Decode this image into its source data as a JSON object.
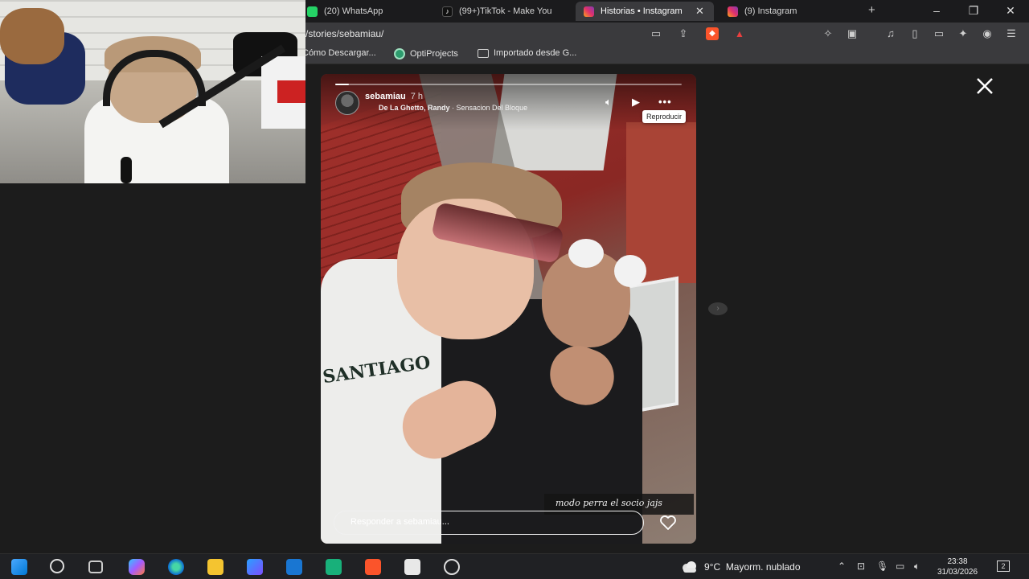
{
  "browser": {
    "tabs": [
      {
        "title": "(20) WhatsApp",
        "icon": "whatsapp-icon",
        "active": false
      },
      {
        "title": "(99+)TikTok - Make You",
        "icon": "tiktok-icon",
        "active": false
      },
      {
        "title": "Historias • Instagram",
        "icon": "instagram-icon",
        "active": true
      },
      {
        "title": "(9) Instagram",
        "icon": "instagram-icon",
        "active": false
      }
    ],
    "new_tab_label": "+",
    "url": "/stories/sebamiau/",
    "bookmarks": [
      {
        "label": "Cómo Descargar...",
        "icon": "bookmark-icon"
      },
      {
        "label": "OptiProjects",
        "icon": "optiprojects-icon"
      },
      {
        "label": "Importado desde G...",
        "icon": "folder-icon"
      }
    ]
  },
  "story": {
    "username": "sebamiau",
    "time_ago": "7 h",
    "song_artist": "De La Ghetto, Randy",
    "song_title": "Sensacion Del Bloque",
    "song_separator": " · ",
    "tooltip": "Reproducir",
    "caption": "modo perra el socio jajs",
    "shirt_print": "SANTIAGO",
    "reply_placeholder": "Responder a sebamiau...",
    "progress": 0.04
  },
  "taskbar": {
    "weather_temp": "9°C",
    "weather_desc": "Mayorm. nublado",
    "time": "23:38",
    "date": "31/03/2026",
    "notification_count": "2"
  },
  "colors": {
    "accent_ig": "#e1306c",
    "brave": "#fb542b",
    "background": "#1c1c1c"
  }
}
